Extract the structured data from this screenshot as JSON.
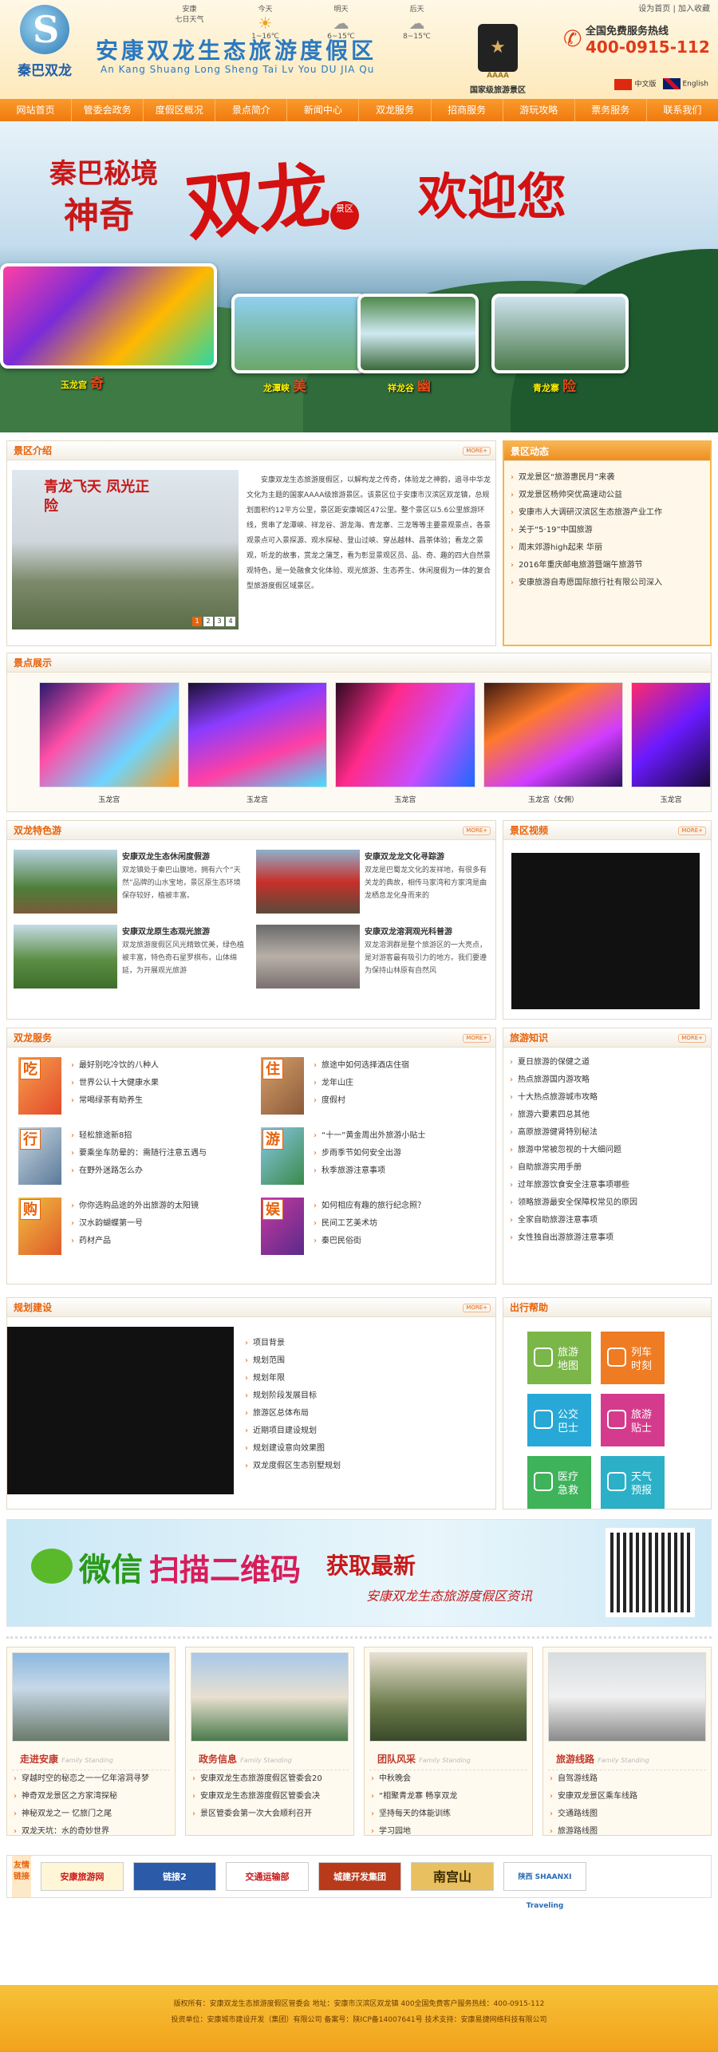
{
  "header": {
    "logo_text": "秦巴双龙",
    "site_title": "安康双龙生态旅游度假区",
    "site_subtitle": "An Kang Shuang Long Sheng Tai Lv You DU JIA Qu",
    "top_links": [
      "设为首页",
      "加入收藏"
    ],
    "aaaa_badge": "AAAA",
    "aaaa_label": "国家级旅游景区",
    "hotline_label": "全国免费服务热线",
    "hotline_number": "400-0915-112",
    "lang_cn": "中文版",
    "lang_en": "English"
  },
  "weather": [
    {
      "city": "安康",
      "desc": "七日天气"
    },
    {
      "day": "今天",
      "temp": "1~16℃"
    },
    {
      "day": "明天",
      "temp": "6~15℃"
    },
    {
      "day": "后天",
      "temp": "8~15℃"
    }
  ],
  "nav": [
    "网站首页",
    "管委会政务",
    "度假区概况",
    "景点简介",
    "新闻中心",
    "双龙服务",
    "招商服务",
    "游玩攻略",
    "票务服务",
    "联系我们"
  ],
  "banner": {
    "line1": "秦巴秘境",
    "line2": "神奇",
    "big": "双龙",
    "badge": "景区",
    "welcome": "欢迎您",
    "photos": [
      {
        "label": "玉龙宫",
        "tag": "奇"
      },
      {
        "label": "龙潭峡",
        "tag": "美"
      },
      {
        "label": "祥龙谷",
        "tag": "幽"
      },
      {
        "label": "青龙寨",
        "tag": "险"
      }
    ]
  },
  "intro": {
    "title": "景区介绍",
    "more": "MORE+",
    "img_text": "青龙飞天 凤光正险",
    "pager": [
      "1",
      "2",
      "3",
      "4"
    ],
    "text": "安康双龙生态旅游度假区，以解构龙之传奇，体验龙之神韵，追寻中华龙文化为主题的国家AAAA级旅游景区。该景区位于安康市汉滨区双龙镇，总规划面积约12平方公里，景区距安康城区47公里。整个景区以5.6公里旅游环线，贯串了龙潭峡、祥龙谷、游龙海、青龙寨、三龙等等主要景观景点，各景观景点可入景探源、观水探秘、登山过峡、穿丛越林、昌茶体验；看龙之景观，听龙的故事，赏龙之蒲芝，看为彰显景观区员、品、奇、趣的四大自然景观特色，是一处融食文化体验、观光旅游、生态养生、休闲度假为一体的复合型旅游度假区域景区。"
  },
  "news": {
    "title": "景区动态",
    "items": [
      "双龙景区“旅游惠民月”来袭",
      "双龙景区杨帅突优高速动公益",
      "安康市人大调研汉滨区生态旅游产业工作",
      "关于“5·19”中国旅游",
      "周末郊游high起来 华丽",
      "2016年重庆邮电旅游暨端午旅游节",
      "安康旅游自寿愿国际旅行社有限公司深入"
    ]
  },
  "scenery": {
    "title": "景点展示",
    "items": [
      "玉龙宫",
      "玉龙宫",
      "玉龙宫",
      "玉龙宫（女佣）",
      "玉龙宫"
    ]
  },
  "features": {
    "title": "双龙特色游",
    "more": "MORE+",
    "items": [
      {
        "title": "安康双龙生态休闲度假游",
        "text": "双龙镇处于秦巴山腹地，拥有六个“天然”品牌的山水宝地，景区原生态环境保存较好，植被丰富。"
      },
      {
        "title": "安康双龙龙文化寻踪游",
        "text": "双龙是巴蜀龙文化的发祥地，有很多有关龙的典故，相传马家湾和方家湾是曲龙栖息龙化身而来的"
      },
      {
        "title": "安康双龙原生态观光旅游",
        "text": "双龙旅游度假区风光精致优美，绿色植被丰富，特色奇石星罗棋布，山体绵延，为开展观光旅游"
      },
      {
        "title": "安康双龙溶洞观光科普游",
        "text": "双龙溶洞群是整个旅游区的一大亮点，是对游客最有吸引力的地方。我们要遵为保持山林原有自然风"
      }
    ]
  },
  "video": {
    "title": "景区视频",
    "more": "MORE+"
  },
  "services": {
    "title": "双龙服务",
    "more": "MORE+",
    "groups": [
      {
        "ch": "吃",
        "items": [
          "最好别吃冷饮的八种人",
          "世界公认十大健康水果",
          "常喝绿茶有助养生"
        ]
      },
      {
        "ch": "住",
        "items": [
          "旅途中如何选择酒店住宿",
          "龙年山庄",
          "度假村"
        ]
      },
      {
        "ch": "行",
        "items": [
          "轻松旅途新8招",
          "要乘坐车防晕的：需随行注意五遇与",
          "在野外迷路怎么办"
        ]
      },
      {
        "ch": "游",
        "items": [
          "“十一”黄金周出外旅游小贴士",
          "步雨季节如何安全出游",
          "秋季旅游注意事项"
        ]
      },
      {
        "ch": "购",
        "items": [
          "你你选购品途的外出旅游的太阳镜",
          "汉水韵蝴蝶第一号",
          "药材产品"
        ]
      },
      {
        "ch": "娱",
        "items": [
          "如何相应有趣的旅行纪念照？",
          "民间工艺美术坊",
          "秦巴民俗街"
        ]
      }
    ]
  },
  "knowledge": {
    "title": "旅游知识",
    "more": "MORE+",
    "items": [
      "夏日旅游的保健之道",
      "热点旅游国内游攻略",
      "十大热点旅游城市攻略",
      "旅游六要素四总其他",
      "高原旅游健肾特别秘法",
      "旅游中常被忽视的十大细问题",
      "自助旅游实用手册",
      "过年旅游饮食安全注意事项哪些",
      "领略旅游最安全保障权常见的原因",
      "全家自助旅游注意事项",
      "女性独自出游旅游注意事项"
    ]
  },
  "planning": {
    "title": "规划建设",
    "more": "MORE+",
    "items": [
      "项目背景",
      "规划范围",
      "规划年限",
      "规划阶段发展目标",
      "旅游区总体布局",
      "近期项目建设规划",
      "规划建设意向效果图",
      "双龙度假区生态别墅规划"
    ]
  },
  "help": {
    "title": "出行帮助",
    "items": [
      {
        "l1": "旅游",
        "l2": "地图",
        "color": "#7ab648"
      },
      {
        "l1": "列车",
        "l2": "时刻",
        "color": "#ef7b23"
      },
      {
        "l1": "公交",
        "l2": "巴士",
        "color": "#27a8d6"
      },
      {
        "l1": "旅游",
        "l2": "贴士",
        "color": "#d53b8d"
      },
      {
        "l1": "医疗",
        "l2": "急救",
        "color": "#3eb35a"
      },
      {
        "l1": "天气",
        "l2": "预报",
        "color": "#2bb0c8"
      }
    ]
  },
  "wechat": {
    "t1": "微信",
    "t2": "扫描二维码",
    "t3": "获取最新",
    "t4": "安康双龙生态旅游度假区资讯"
  },
  "cards": [
    {
      "title": "走进安康",
      "sub": "Family Standing",
      "items": [
        "穿越时空的秘恋之一一亿年溶洞寻梦",
        "神奇双龙景区之方家湾探秘",
        "神秘双龙之一 忆旅门之尾",
        "双龙天坑：水的奇妙世界"
      ]
    },
    {
      "title": "政务信息",
      "sub": "Family Standing",
      "items": [
        "安康双龙生态旅游度假区管委会20",
        "安康双龙生态旅游度假区管委会决",
        "景区管委会第一次大会顺利召开"
      ]
    },
    {
      "title": "团队风采",
      "sub": "Family Standing",
      "items": [
        "中秋晚会",
        "“相聚青龙寨 畅享双龙",
        "坚持每天的体能训练",
        "学习园地"
      ]
    },
    {
      "title": "旅游线路",
      "sub": "Family Standing",
      "items": [
        "自驾游线路",
        "安康双龙景区乘车线路",
        "交通路线图",
        "旅游路线图"
      ]
    }
  ],
  "friend_links": {
    "label": "友情链接",
    "items": [
      "安康旅游网",
      "链接2",
      "交通运输部",
      "城建开发集团",
      "南宫山",
      "陕西 SHAANXI Traveling"
    ]
  },
  "footer": {
    "line1": "版权所有：安康双龙生态旅游度假区管委会  地址：安康市汉滨区双龙镇  400全国免费客户服务热线：400-0915-112",
    "line2": "投资单位：安康城市建设开发（集团）有限公司  备案号：陕ICP备14007641号  技术支持：安康易捷网络科技有限公司"
  }
}
